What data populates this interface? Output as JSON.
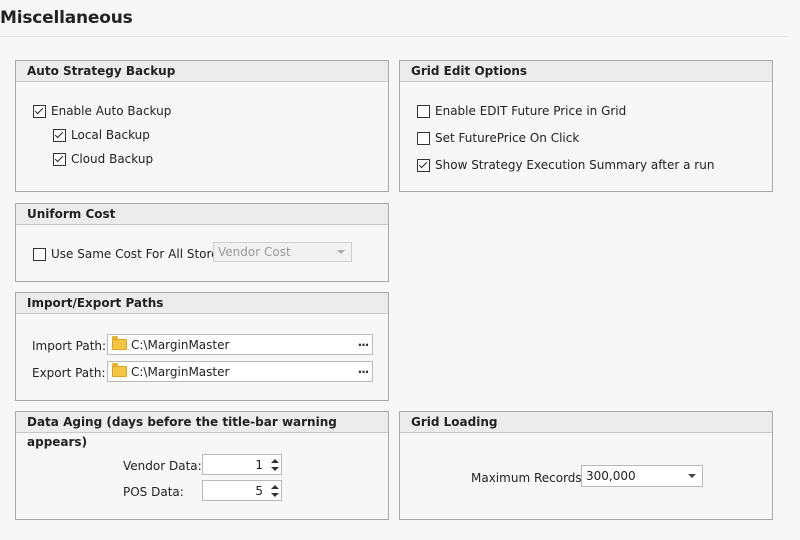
{
  "page": {
    "title": "Miscellaneous"
  },
  "auto_backup": {
    "title": "Auto Strategy Backup",
    "enable": {
      "label": "Enable Auto Backup",
      "checked": true
    },
    "local": {
      "label": "Local Backup",
      "checked": true
    },
    "cloud": {
      "label": "Cloud Backup",
      "checked": true
    }
  },
  "grid_edit": {
    "title": "Grid Edit Options",
    "edit_future_price": {
      "label": "Enable EDIT Future Price in Grid",
      "checked": false
    },
    "future_price_click": {
      "label": "Set FuturePrice On Click",
      "checked": false
    },
    "show_summary": {
      "label": "Show Strategy Execution Summary after a run",
      "checked": true
    }
  },
  "uniform_cost": {
    "title": "Uniform Cost",
    "same_cost": {
      "label": "Use Same Cost For All Stores",
      "checked": false
    },
    "cost_select": {
      "value": "Vendor Cost",
      "disabled": true
    }
  },
  "paths": {
    "title": "Import/Export Paths",
    "import": {
      "label": "Import Path:",
      "value": "C:\\MarginMaster",
      "button": "···"
    },
    "export": {
      "label": "Export Path:",
      "value": "C:\\MarginMaster",
      "button": "···"
    }
  },
  "data_aging": {
    "title": "Data Aging (days before the title-bar warning appears)",
    "vendor": {
      "label": "Vendor Data:",
      "value": "1"
    },
    "pos": {
      "label": "POS Data:",
      "value": "5"
    }
  },
  "grid_loading": {
    "title": "Grid Loading",
    "max_records": {
      "label": "Maximum Records:",
      "value": "300,000"
    }
  },
  "icons": {
    "folder": "folder-icon",
    "ellipsis": "ellipsis-icon",
    "dropdown": "chevron-down-icon",
    "spin_up": "spin-up-icon",
    "spin_down": "spin-down-icon"
  }
}
